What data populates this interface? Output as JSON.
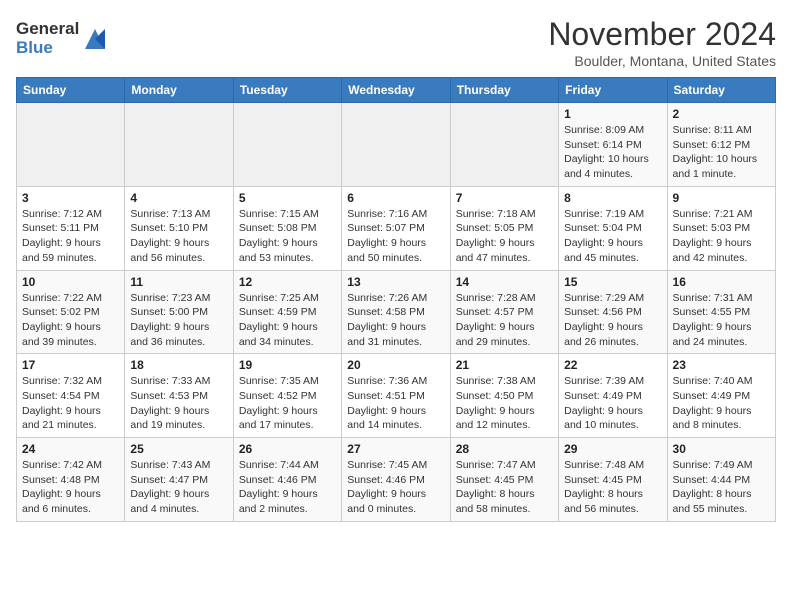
{
  "header": {
    "logo_general": "General",
    "logo_blue": "Blue",
    "month_year": "November 2024",
    "location": "Boulder, Montana, United States"
  },
  "days_of_week": [
    "Sunday",
    "Monday",
    "Tuesday",
    "Wednesday",
    "Thursday",
    "Friday",
    "Saturday"
  ],
  "weeks": [
    [
      {
        "day": "",
        "info": ""
      },
      {
        "day": "",
        "info": ""
      },
      {
        "day": "",
        "info": ""
      },
      {
        "day": "",
        "info": ""
      },
      {
        "day": "",
        "info": ""
      },
      {
        "day": "1",
        "info": "Sunrise: 8:09 AM\nSunset: 6:14 PM\nDaylight: 10 hours and 4 minutes."
      },
      {
        "day": "2",
        "info": "Sunrise: 8:11 AM\nSunset: 6:12 PM\nDaylight: 10 hours and 1 minute."
      }
    ],
    [
      {
        "day": "3",
        "info": "Sunrise: 7:12 AM\nSunset: 5:11 PM\nDaylight: 9 hours and 59 minutes."
      },
      {
        "day": "4",
        "info": "Sunrise: 7:13 AM\nSunset: 5:10 PM\nDaylight: 9 hours and 56 minutes."
      },
      {
        "day": "5",
        "info": "Sunrise: 7:15 AM\nSunset: 5:08 PM\nDaylight: 9 hours and 53 minutes."
      },
      {
        "day": "6",
        "info": "Sunrise: 7:16 AM\nSunset: 5:07 PM\nDaylight: 9 hours and 50 minutes."
      },
      {
        "day": "7",
        "info": "Sunrise: 7:18 AM\nSunset: 5:05 PM\nDaylight: 9 hours and 47 minutes."
      },
      {
        "day": "8",
        "info": "Sunrise: 7:19 AM\nSunset: 5:04 PM\nDaylight: 9 hours and 45 minutes."
      },
      {
        "day": "9",
        "info": "Sunrise: 7:21 AM\nSunset: 5:03 PM\nDaylight: 9 hours and 42 minutes."
      }
    ],
    [
      {
        "day": "10",
        "info": "Sunrise: 7:22 AM\nSunset: 5:02 PM\nDaylight: 9 hours and 39 minutes."
      },
      {
        "day": "11",
        "info": "Sunrise: 7:23 AM\nSunset: 5:00 PM\nDaylight: 9 hours and 36 minutes."
      },
      {
        "day": "12",
        "info": "Sunrise: 7:25 AM\nSunset: 4:59 PM\nDaylight: 9 hours and 34 minutes."
      },
      {
        "day": "13",
        "info": "Sunrise: 7:26 AM\nSunset: 4:58 PM\nDaylight: 9 hours and 31 minutes."
      },
      {
        "day": "14",
        "info": "Sunrise: 7:28 AM\nSunset: 4:57 PM\nDaylight: 9 hours and 29 minutes."
      },
      {
        "day": "15",
        "info": "Sunrise: 7:29 AM\nSunset: 4:56 PM\nDaylight: 9 hours and 26 minutes."
      },
      {
        "day": "16",
        "info": "Sunrise: 7:31 AM\nSunset: 4:55 PM\nDaylight: 9 hours and 24 minutes."
      }
    ],
    [
      {
        "day": "17",
        "info": "Sunrise: 7:32 AM\nSunset: 4:54 PM\nDaylight: 9 hours and 21 minutes."
      },
      {
        "day": "18",
        "info": "Sunrise: 7:33 AM\nSunset: 4:53 PM\nDaylight: 9 hours and 19 minutes."
      },
      {
        "day": "19",
        "info": "Sunrise: 7:35 AM\nSunset: 4:52 PM\nDaylight: 9 hours and 17 minutes."
      },
      {
        "day": "20",
        "info": "Sunrise: 7:36 AM\nSunset: 4:51 PM\nDaylight: 9 hours and 14 minutes."
      },
      {
        "day": "21",
        "info": "Sunrise: 7:38 AM\nSunset: 4:50 PM\nDaylight: 9 hours and 12 minutes."
      },
      {
        "day": "22",
        "info": "Sunrise: 7:39 AM\nSunset: 4:49 PM\nDaylight: 9 hours and 10 minutes."
      },
      {
        "day": "23",
        "info": "Sunrise: 7:40 AM\nSunset: 4:49 PM\nDaylight: 9 hours and 8 minutes."
      }
    ],
    [
      {
        "day": "24",
        "info": "Sunrise: 7:42 AM\nSunset: 4:48 PM\nDaylight: 9 hours and 6 minutes."
      },
      {
        "day": "25",
        "info": "Sunrise: 7:43 AM\nSunset: 4:47 PM\nDaylight: 9 hours and 4 minutes."
      },
      {
        "day": "26",
        "info": "Sunrise: 7:44 AM\nSunset: 4:46 PM\nDaylight: 9 hours and 2 minutes."
      },
      {
        "day": "27",
        "info": "Sunrise: 7:45 AM\nSunset: 4:46 PM\nDaylight: 9 hours and 0 minutes."
      },
      {
        "day": "28",
        "info": "Sunrise: 7:47 AM\nSunset: 4:45 PM\nDaylight: 8 hours and 58 minutes."
      },
      {
        "day": "29",
        "info": "Sunrise: 7:48 AM\nSunset: 4:45 PM\nDaylight: 8 hours and 56 minutes."
      },
      {
        "day": "30",
        "info": "Sunrise: 7:49 AM\nSunset: 4:44 PM\nDaylight: 8 hours and 55 minutes."
      }
    ]
  ]
}
